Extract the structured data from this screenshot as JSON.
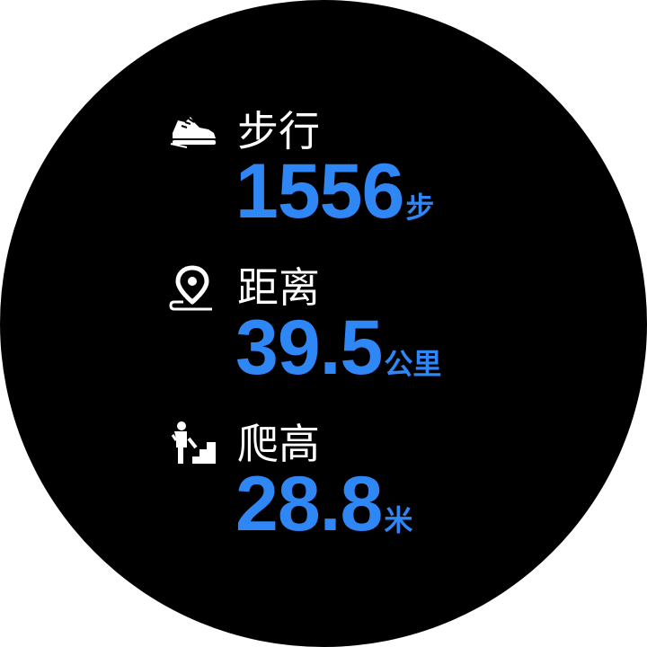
{
  "metrics": [
    {
      "label": "步行",
      "value": "1556",
      "unit": "步",
      "icon": "shoe-icon"
    },
    {
      "label": "距离",
      "value": "39.5",
      "unit": "公里",
      "icon": "location-pin-icon"
    },
    {
      "label": "爬高",
      "value": "28.8",
      "unit": "米",
      "icon": "climb-stairs-icon"
    }
  ],
  "colors": {
    "accent": "#2f86f5",
    "background": "#000000",
    "label": "#ffffff"
  }
}
